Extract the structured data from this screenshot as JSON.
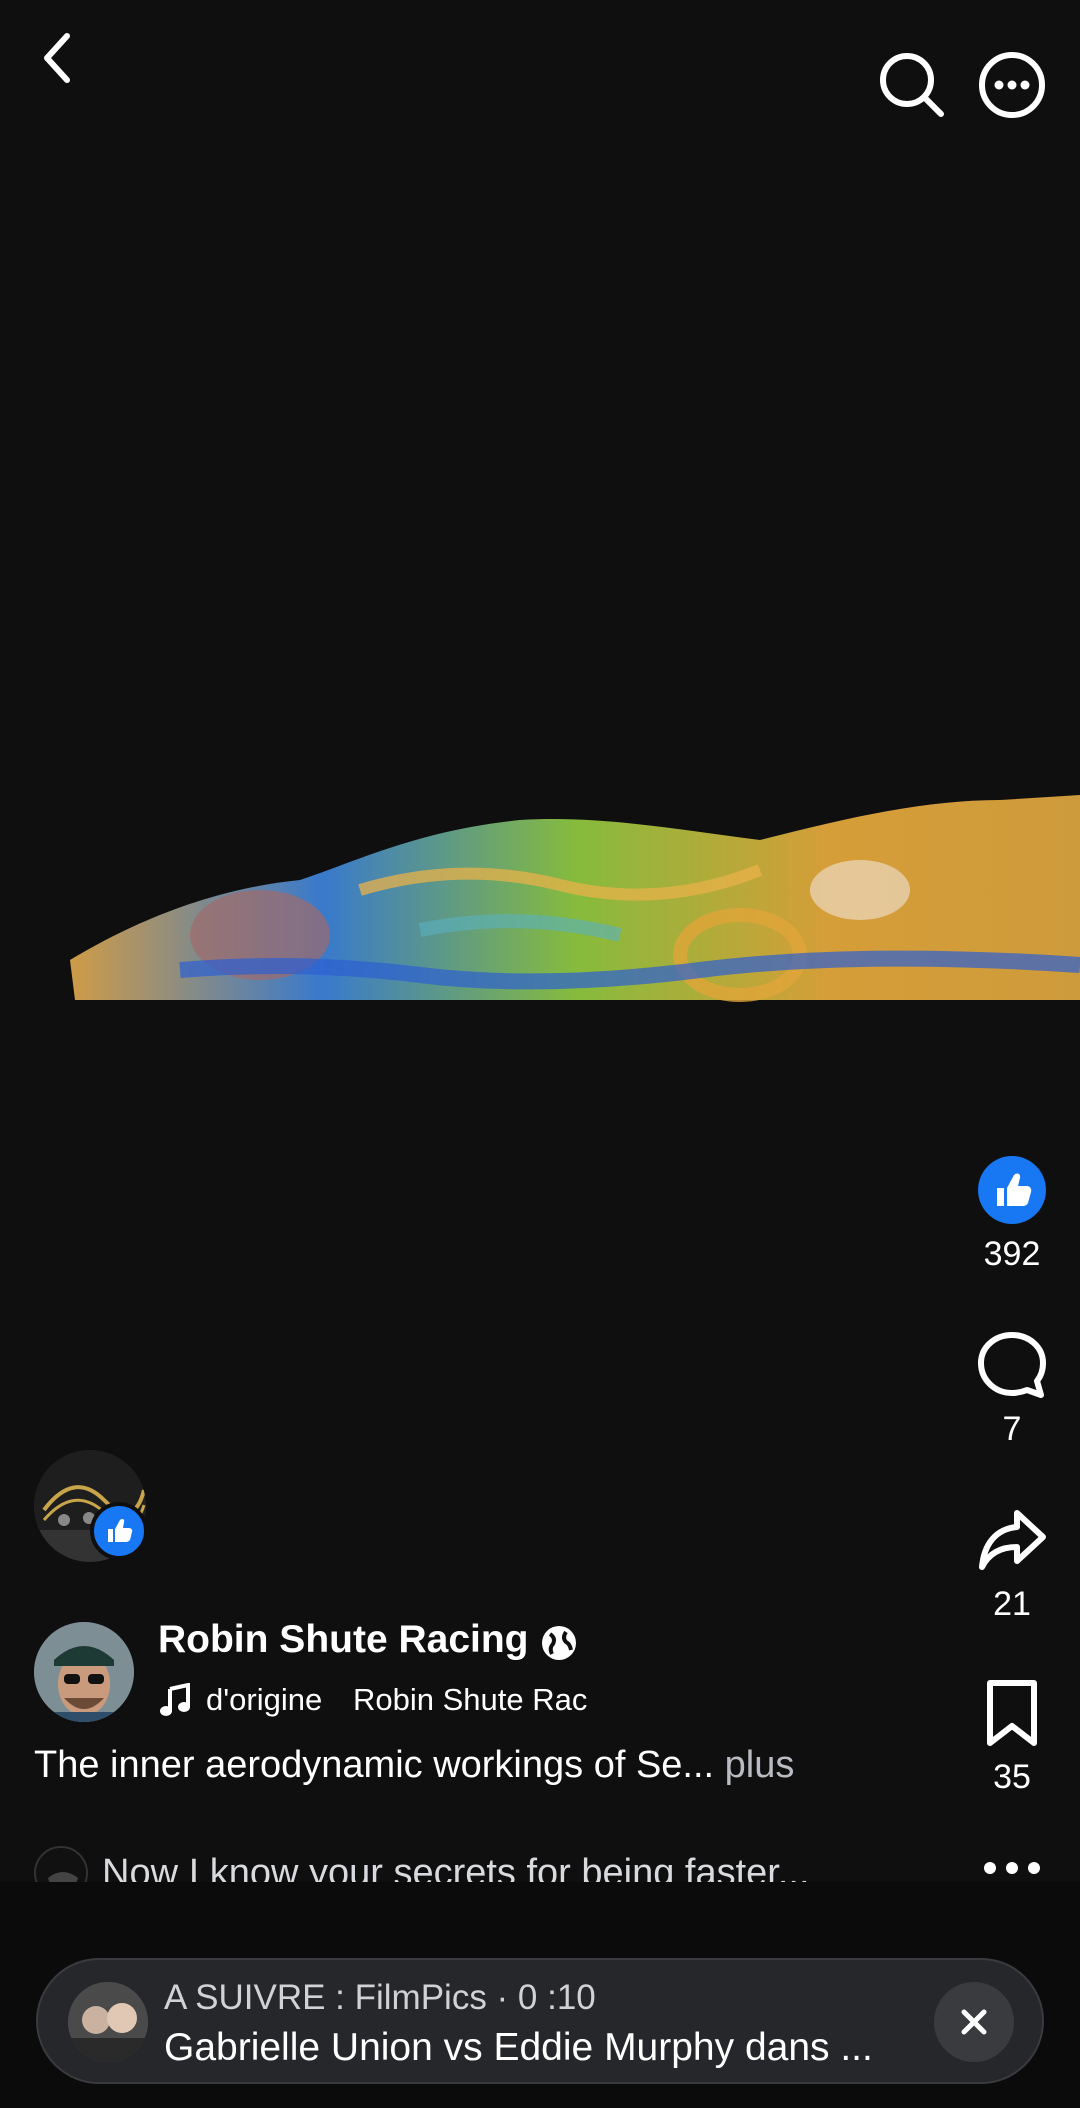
{
  "video": {
    "description": ""
  },
  "reactions": {
    "likes": "392",
    "comments": "7",
    "shares": "21",
    "saves": "35"
  },
  "author": {
    "name": "Robin Shute Racing"
  },
  "audio": {
    "name": "d'origine",
    "author": "Robin Shute Rac"
  },
  "caption": {
    "text": "The inner aerodynamic workings of Se...",
    "more": "plus"
  },
  "comment_preview": {
    "text": "Now I know your secrets for being faster..."
  },
  "up_next": {
    "label": "A SUIVRE : FilmPics · 0 :10",
    "title": "Gabrielle Union vs Eddie Murphy  dans ..."
  },
  "colors": {
    "accent": "#1877f2",
    "background": "#0f0f10",
    "pill": "#26272a"
  },
  "icons": [
    "back-icon",
    "search-icon",
    "more-horizontal-icon",
    "like-icon",
    "comment-icon",
    "share-icon",
    "bookmark-icon",
    "globe-icon",
    "music-icon",
    "close-icon"
  ]
}
